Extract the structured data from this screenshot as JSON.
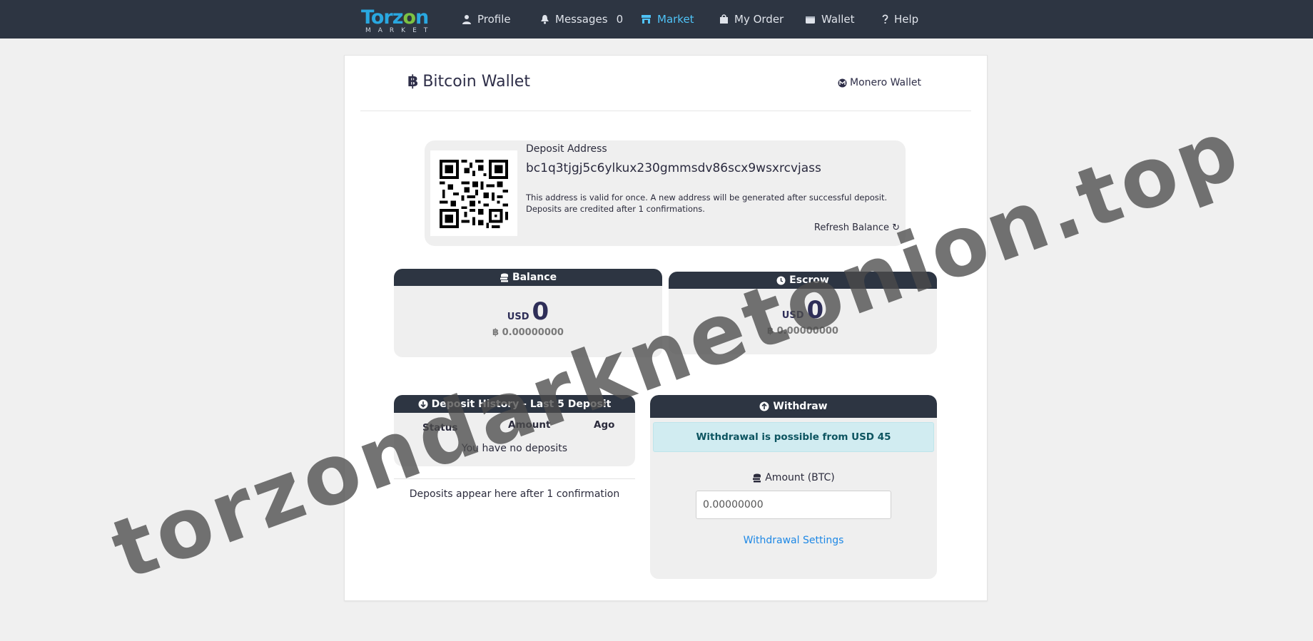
{
  "nav": {
    "logo_main": "Torzon",
    "logo_sub": "MARKET",
    "items": [
      {
        "label": "Profile",
        "icon": "user-icon"
      },
      {
        "label": "Messages",
        "icon": "bell-icon",
        "badge": "0"
      },
      {
        "label": "Market",
        "icon": "store-icon",
        "active": true
      },
      {
        "label": "My Order",
        "icon": "bag-icon"
      },
      {
        "label": "Wallet",
        "icon": "wallet-icon"
      },
      {
        "label": "Help",
        "icon": "question-icon"
      }
    ]
  },
  "wallet": {
    "title": "Bitcoin Wallet",
    "btc_glyph": "฿",
    "switch_link": "Monero Wallet"
  },
  "deposit": {
    "label": "Deposit Address",
    "address": "bc1q3tjgj5c6ylkux230gmmsdv86scx9wsxrcvjass",
    "note_line1": "This address is valid for once. A new address will be generated after successful deposit.",
    "note_line2": "Deposits are credited after 1 confirmations.",
    "refresh_label": "Refresh Balance ↻"
  },
  "balance": {
    "title": "Balance",
    "currency": "USD",
    "usd_value": "0",
    "btc_value": "฿ 0.00000000"
  },
  "escrow": {
    "title": "Escrow",
    "currency": "USD",
    "usd_value": "0",
    "btc_value": "฿ 0.00000000"
  },
  "history": {
    "title": "Deposit History - Last 5 Deposit",
    "columns": [
      "Status",
      "Amount",
      "Ago"
    ],
    "empty_text": "You have no deposits",
    "footer_note": "Deposits appear here after 1 confirmation"
  },
  "withdraw": {
    "title": "Withdraw",
    "alert": "Withdrawal is possible from USD 45",
    "amount_label": "Amount (BTC)",
    "amount_value": "0.00000000",
    "settings_link": "Withdrawal Settings"
  },
  "watermark": "torzondarknetonion.top",
  "colors": {
    "navbar": "#2d3542",
    "accent": "#4fc3f7",
    "link": "#1e88e5",
    "alert_bg": "#d1ecf1",
    "alert_text": "#0c5460",
    "logo_blue": "#29a8e0",
    "logo_green": "#7cc242"
  }
}
